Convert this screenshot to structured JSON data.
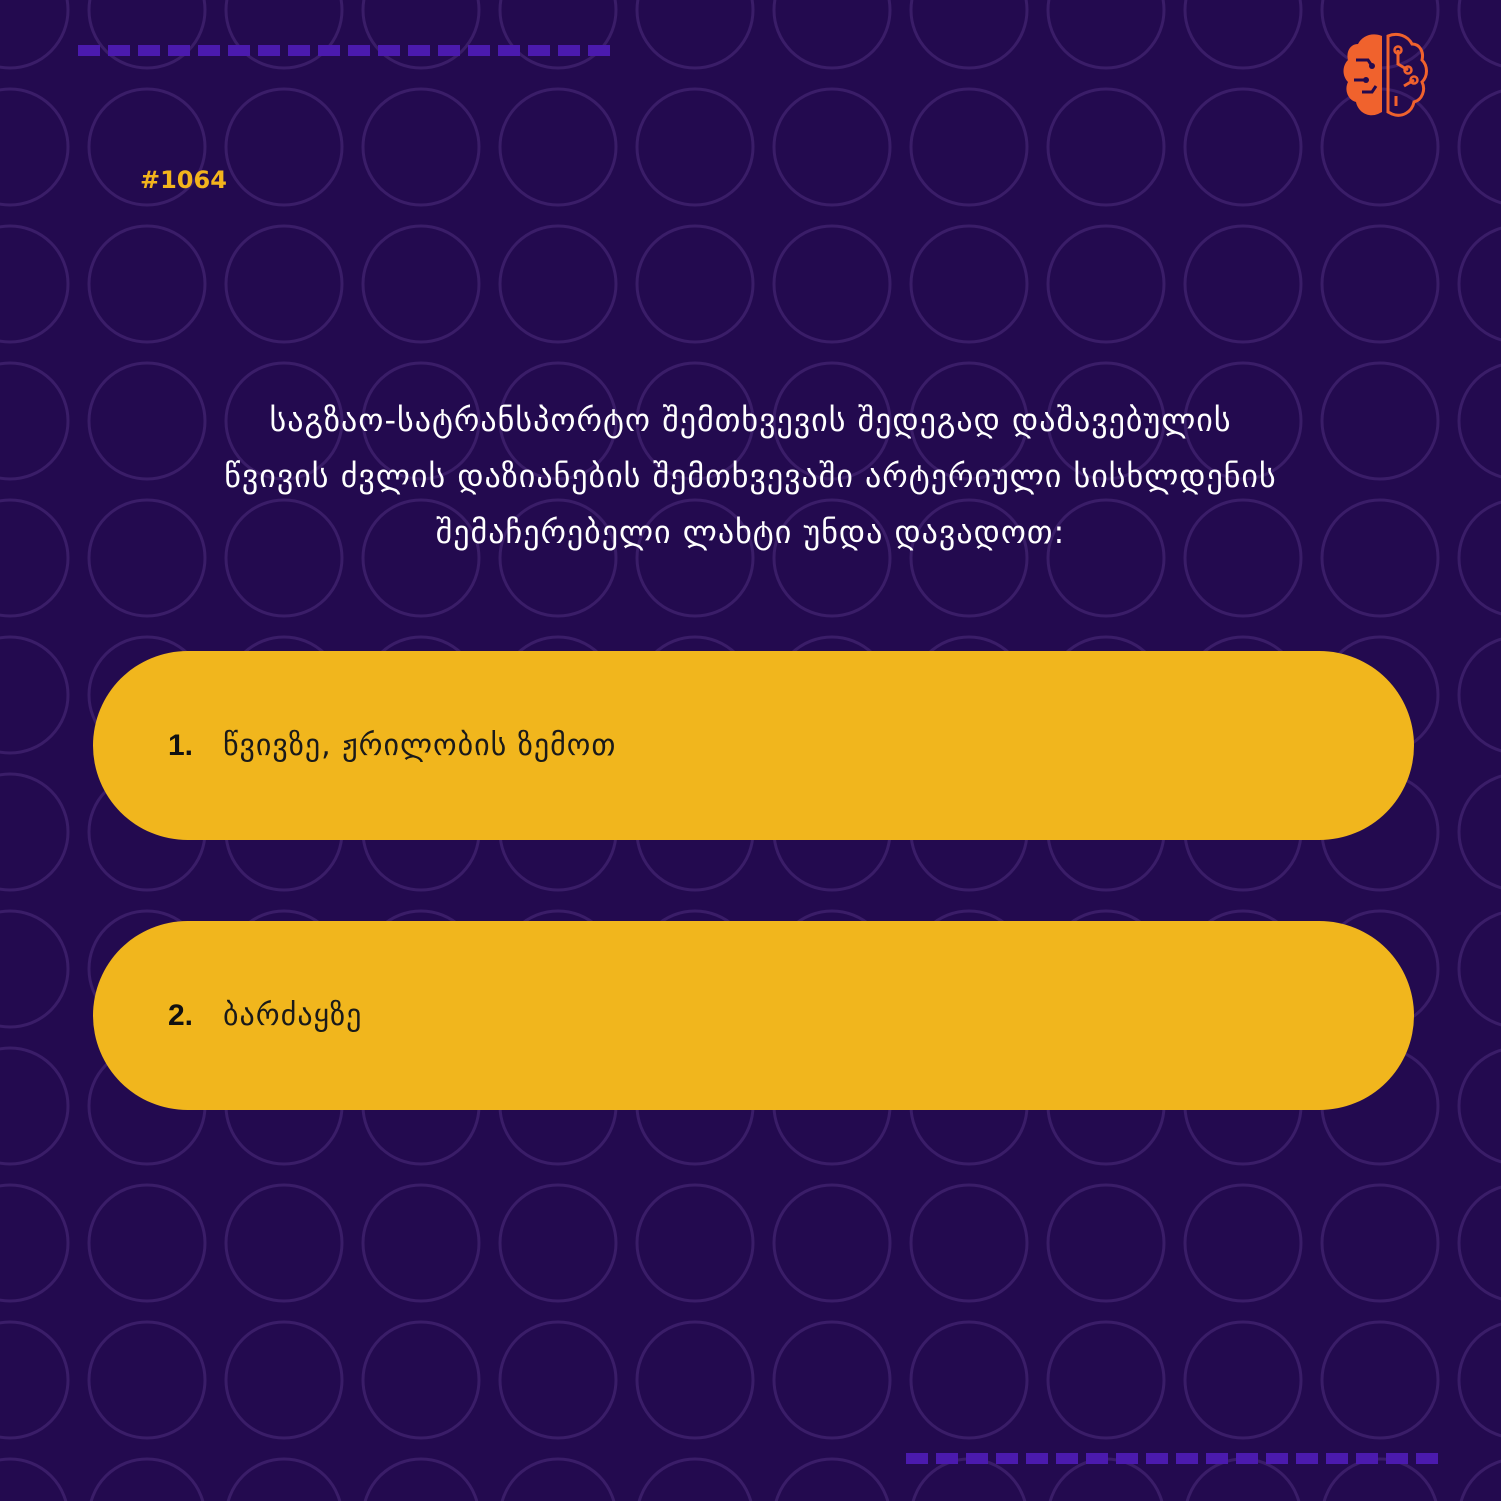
{
  "colors": {
    "background": "#230a4f",
    "accent_yellow": "#f1b61d",
    "dash_purple": "#4b1aae",
    "logo_orange": "#f0622d",
    "circle_pattern": "#3a1d68"
  },
  "logo": {
    "icon": "brain-circuit-icon"
  },
  "question": {
    "number": "#1064",
    "lines": [
      "საგზაო-სატრანსპორტო შემთხვევის შედეგად დაშავებულის",
      "წვივის ძვლის დაზიანების შემთხვევაში არტერიული სისხლდენის",
      "შემაჩერებელი ლახტი უნდა დავადოთ:"
    ]
  },
  "answers": [
    {
      "number": "1.",
      "text": "წვივზე, ჟრილობის ზემოთ"
    },
    {
      "number": "2.",
      "text": "ბარძაყზე"
    }
  ]
}
